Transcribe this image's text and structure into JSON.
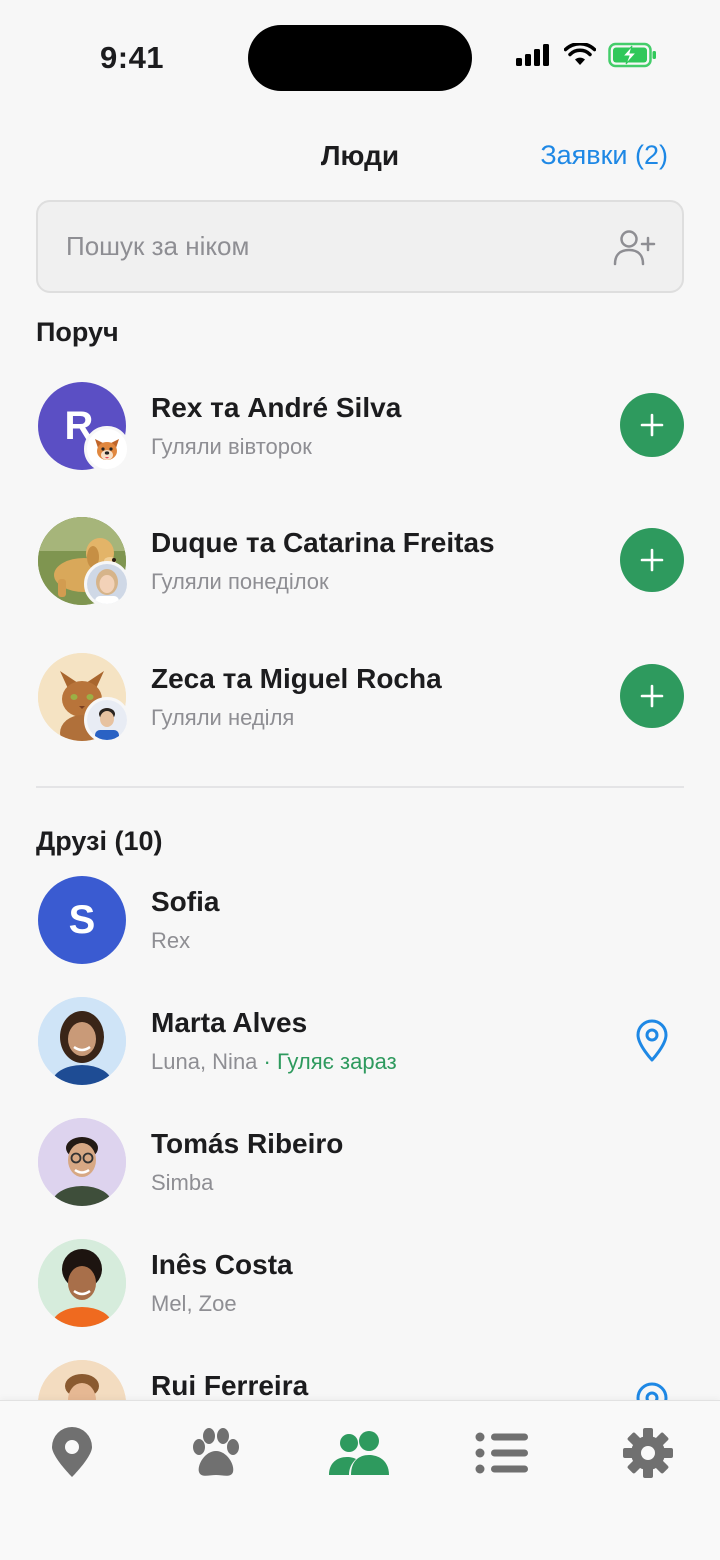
{
  "status": {
    "time": "9:41"
  },
  "header": {
    "title": "Люди",
    "requests_label": "Заявки (2)"
  },
  "search": {
    "placeholder": "Пошук за ніком",
    "value": ""
  },
  "nearby": {
    "title": "Поруч",
    "items": [
      {
        "name": "Rex та André Silva",
        "sub": "Гуляли вівторок",
        "initial": "R",
        "avatar_color": "#5b4fc4"
      },
      {
        "name": "Duque та Catarina Freitas",
        "sub": "Гуляли понеділок"
      },
      {
        "name": "Zeca та Miguel Rocha",
        "sub": "Гуляли неділя"
      }
    ]
  },
  "friends": {
    "title": "Друзі (10)",
    "items": [
      {
        "name": "Sofia",
        "sub": "Rex",
        "initial": "S",
        "avatar_color": "#3a5bd1"
      },
      {
        "name": "Marta Alves",
        "sub": "Luna, Nina",
        "status": " · Гуляє зараз"
      },
      {
        "name": "Tomás Ribeiro",
        "sub": "Simba"
      },
      {
        "name": "Inês Costa",
        "sub": "Mel, Zoe"
      },
      {
        "name": "Rui Ferreira",
        "sub": ""
      }
    ]
  },
  "tabs": [
    {
      "icon": "map-pin-icon",
      "active": false
    },
    {
      "icon": "paw-icon",
      "active": false
    },
    {
      "icon": "people-icon",
      "active": true
    },
    {
      "icon": "list-icon",
      "active": false
    },
    {
      "icon": "gear-icon",
      "active": false
    }
  ],
  "colors": {
    "accent_green": "#2e9a5e",
    "link_blue": "#1e88e5",
    "inactive_icon": "#707070"
  }
}
